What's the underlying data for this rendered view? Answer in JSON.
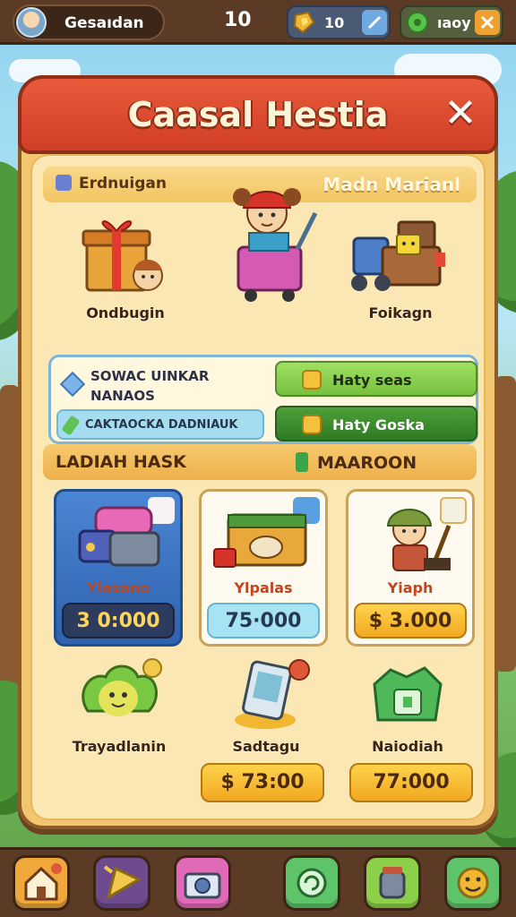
{
  "topbar": {
    "profile_name": "Gesaıdan",
    "level": "10",
    "gold_value": "10",
    "gold_add_icon": "cross-icon",
    "gems_value": "ıaoy",
    "gems_add_icon": "close-icon"
  },
  "panel": {
    "title": "Caasal Hestia",
    "close_glyph": "✕"
  },
  "section1": {
    "left_label": "Erdnuigan",
    "right_label": "Madn Marianl",
    "items": [
      {
        "label": "Ondbugin"
      },
      {
        "label": ""
      },
      {
        "label": "Foikagn"
      }
    ]
  },
  "bonus": {
    "line1": "SOWAC UINKAR",
    "line2": "NANAOS",
    "bar_text": "CAKTAOCKA DADNIAUK",
    "button_light": "Haty seas",
    "button_dark": "Haty Goska"
  },
  "section2": {
    "left_label": "LADIAH HASK",
    "right_label": "MAAROON",
    "cards": [
      {
        "label": "Ylasano",
        "price": "3 0:000"
      },
      {
        "label": "Ylpalas",
        "price": "75·000"
      },
      {
        "label": "Yiaph",
        "price": "$ 3.000"
      }
    ],
    "bottom_items": [
      {
        "label": "Trayadlanin",
        "price": ""
      },
      {
        "label": "Sadtagu",
        "price": "$ 73:00"
      },
      {
        "label": "Naiodiah",
        "price": "77:000"
      }
    ]
  },
  "nav": {
    "buttons": [
      "home-icon",
      "flag-icon",
      "camera-icon",
      "refresh-icon",
      "jar-icon",
      "smile-icon"
    ]
  },
  "colors": {
    "header_red": "#d13e26",
    "panel_gold": "#f1c66e",
    "button_green": "#77c13f",
    "price_orange": "#f2a821"
  }
}
